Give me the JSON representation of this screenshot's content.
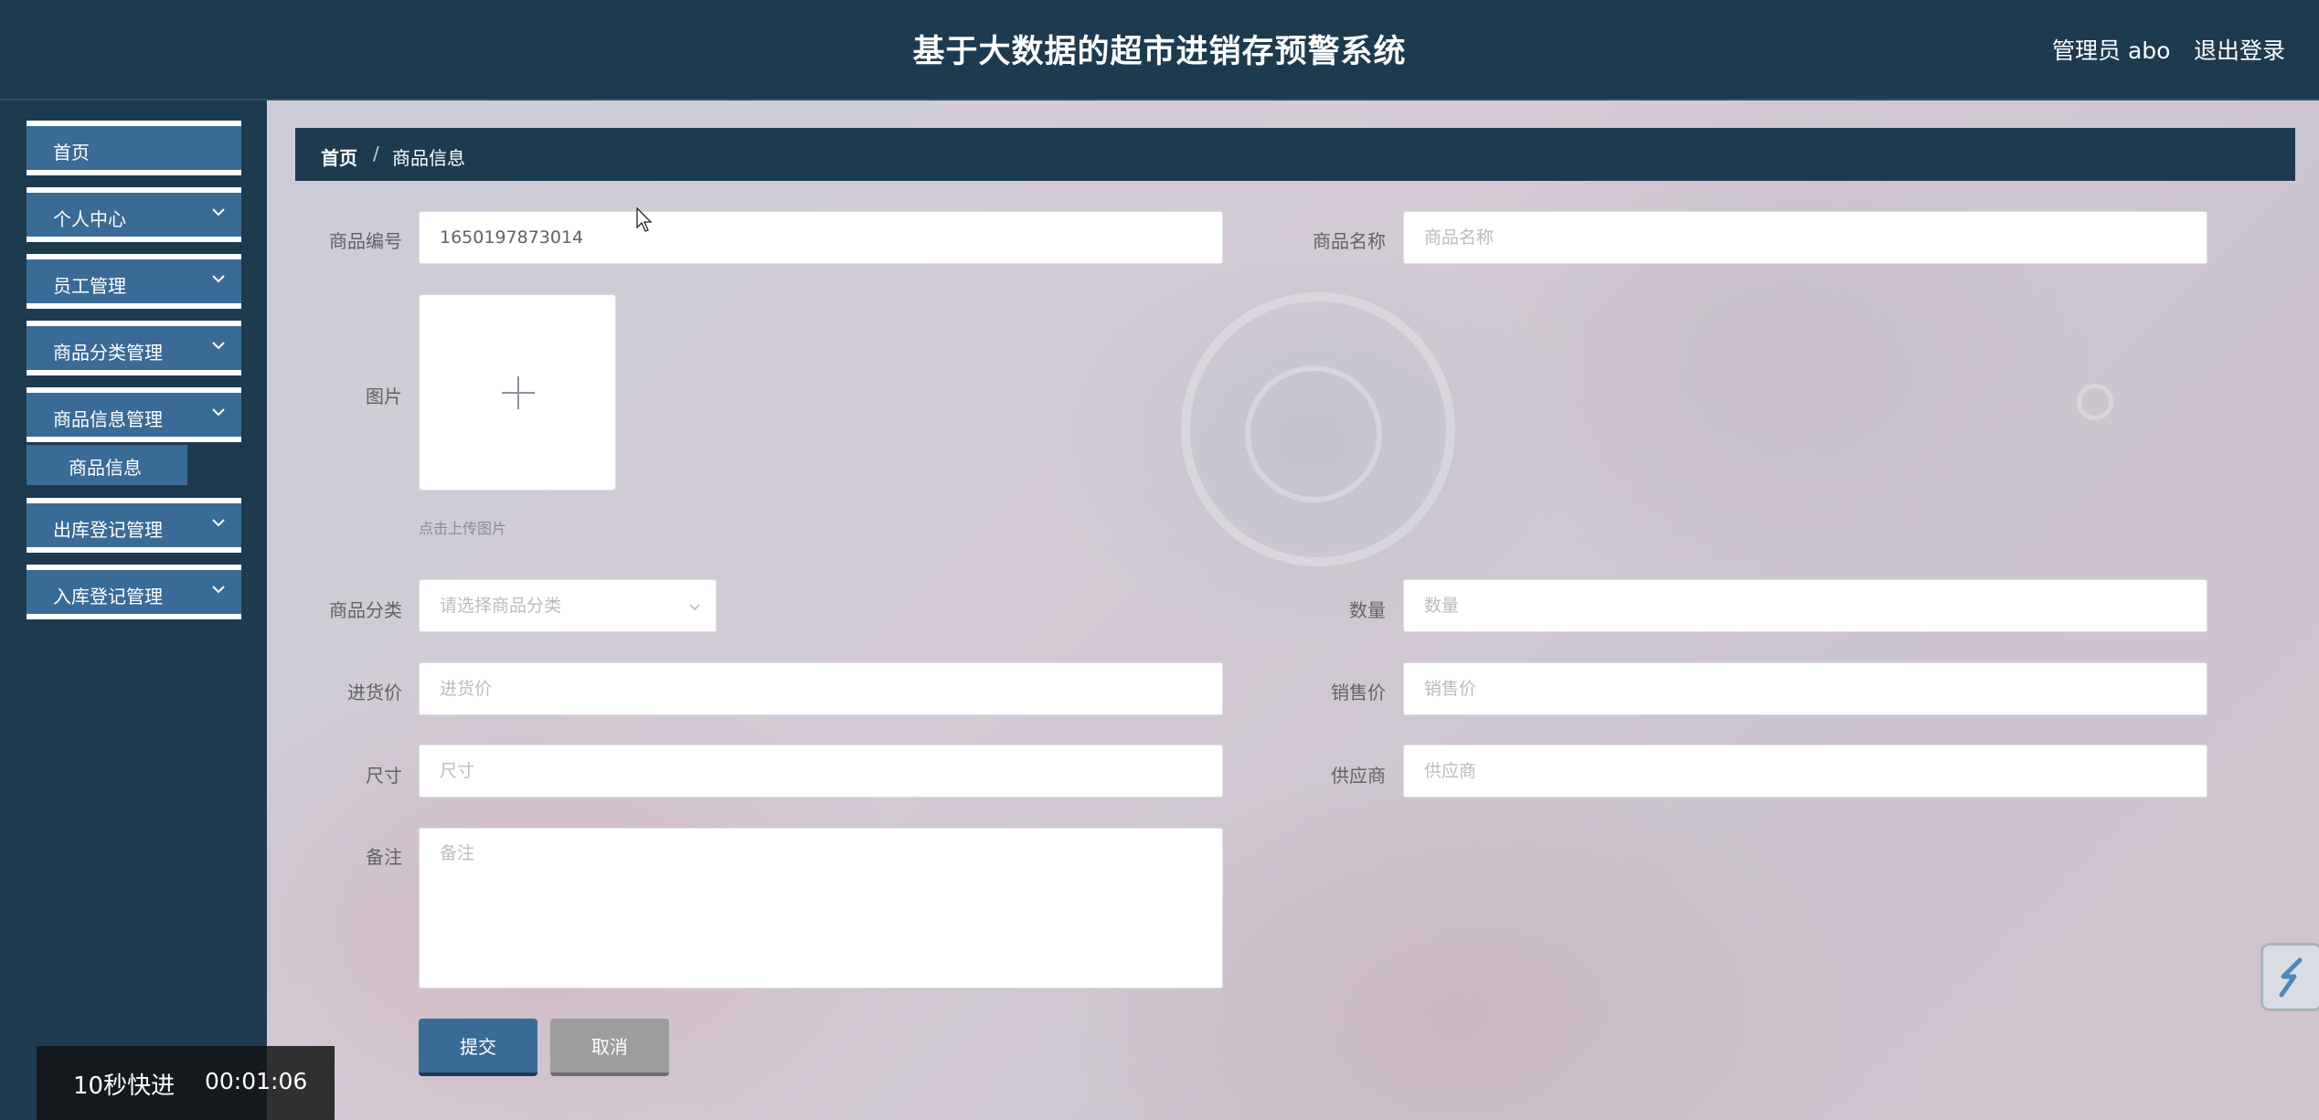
{
  "header": {
    "title": "基于大数据的超市进销存预警系统",
    "user": "管理员 abo",
    "logout": "退出登录"
  },
  "sidebar": {
    "items": [
      {
        "label": "首页"
      },
      {
        "label": "个人中心"
      },
      {
        "label": "员工管理"
      },
      {
        "label": "商品分类管理"
      },
      {
        "label": "商品信息管理"
      },
      {
        "label": "出库登记管理"
      },
      {
        "label": "入库登记管理"
      }
    ],
    "sub_item": "商品信息"
  },
  "breadcrumb": {
    "home": "首页",
    "separator": "/",
    "current": "商品信息"
  },
  "form": {
    "code": {
      "label": "商品编号",
      "value": "1650197873014"
    },
    "name": {
      "label": "商品名称",
      "placeholder": "商品名称"
    },
    "image": {
      "label": "图片",
      "tip": "点击上传图片"
    },
    "category": {
      "label": "商品分类",
      "placeholder": "请选择商品分类"
    },
    "quantity": {
      "label": "数量",
      "placeholder": "数量"
    },
    "purchase_price": {
      "label": "进货价",
      "placeholder": "进货价"
    },
    "sale_price": {
      "label": "销售价",
      "placeholder": "销售价"
    },
    "size": {
      "label": "尺寸",
      "placeholder": "尺寸"
    },
    "supplier": {
      "label": "供应商",
      "placeholder": "供应商"
    },
    "remark": {
      "label": "备注",
      "placeholder": "备注"
    },
    "submit": "提交",
    "cancel": "取消"
  },
  "video_overlay": {
    "fast_forward": "10秒快进",
    "time": "00:01:06"
  },
  "colors": {
    "primary": "#3a6b96",
    "dark": "#1e3a4f",
    "cancel": "#9d9d9d"
  }
}
